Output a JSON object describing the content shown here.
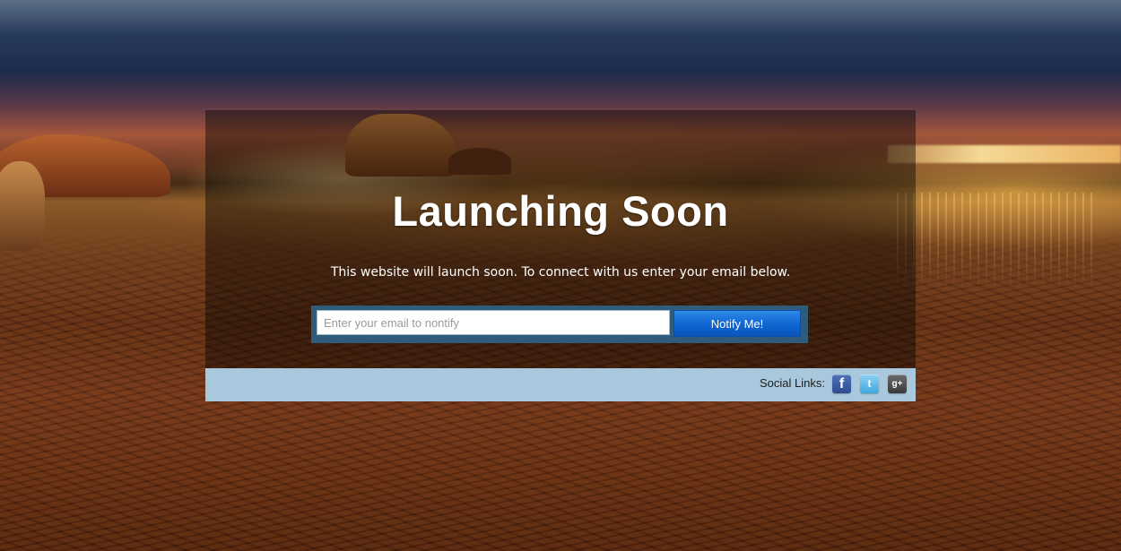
{
  "page": {
    "headline": "Launching Soon",
    "subtext": "This website will launch soon. To connect with us enter your email below."
  },
  "signup": {
    "email_placeholder": "Enter your email to nontify",
    "email_value": "",
    "button_label": "Notify Me!"
  },
  "footer": {
    "social_label": "Social Links:",
    "icons": [
      {
        "name": "facebook-icon",
        "glyph": "f"
      },
      {
        "name": "twitter-icon",
        "glyph": "t"
      },
      {
        "name": "google-plus-icon",
        "glyph": "g+"
      }
    ]
  },
  "colors": {
    "panel_overlay": "#000000",
    "form_frame": "#2f5c7a",
    "button": "#1167d4",
    "footer_strip": "#a9c8dd"
  }
}
